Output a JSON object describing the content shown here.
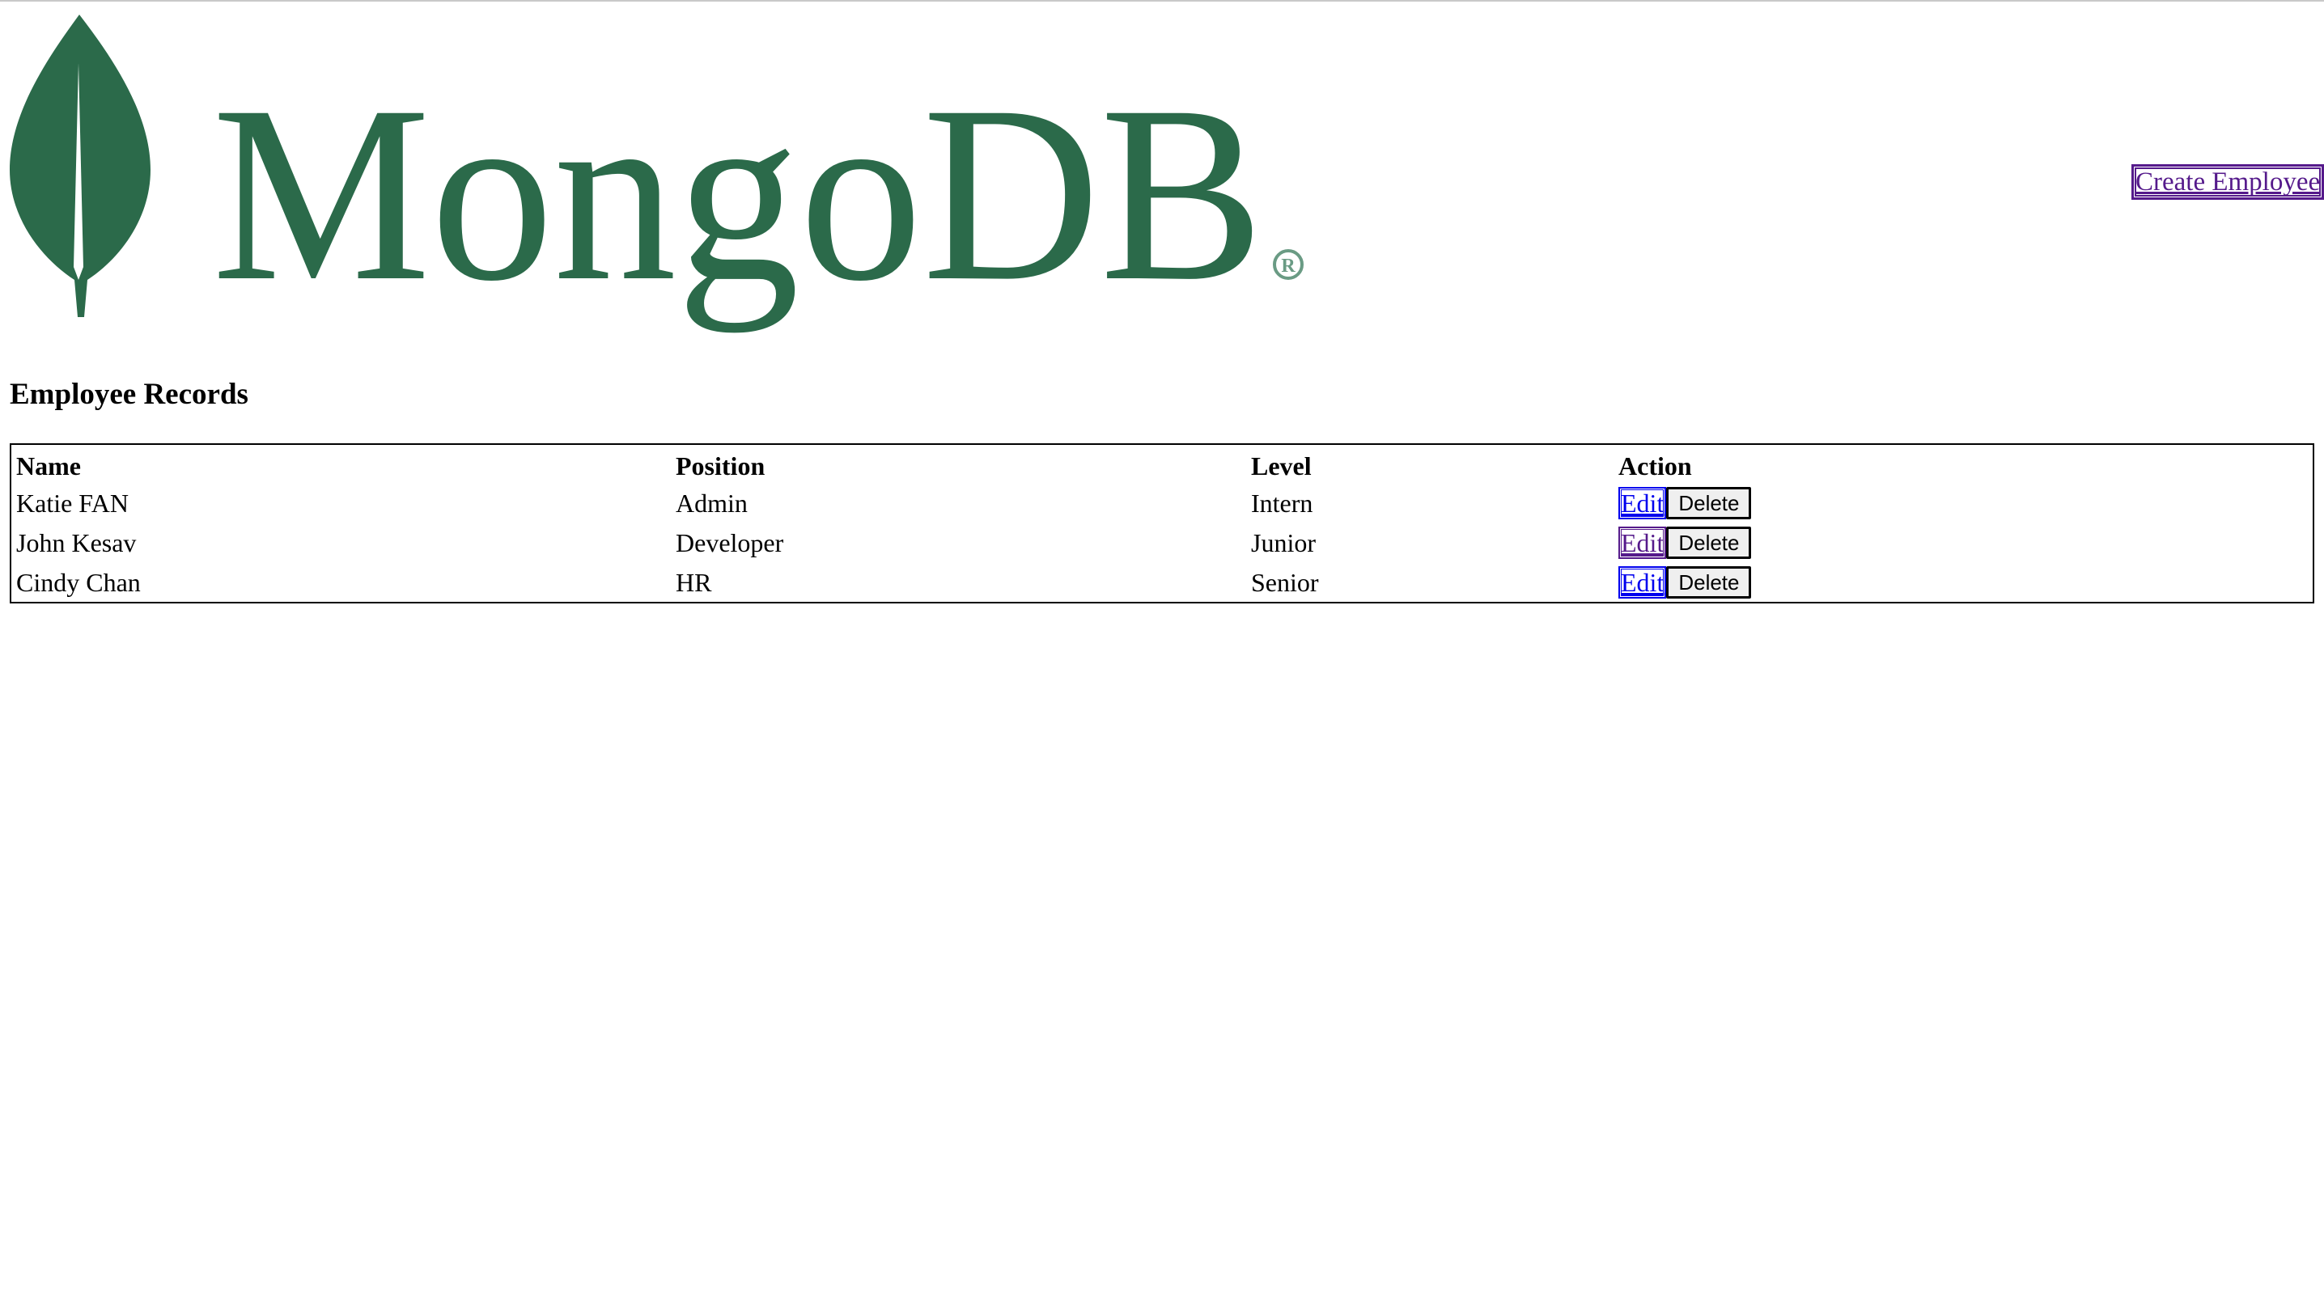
{
  "logo": {
    "wordmark": "MongoDB",
    "registered_mark": "®",
    "brand_color": "#2b6a4a",
    "icon": "leaf-icon"
  },
  "header": {
    "create_link_label": "Create Employee"
  },
  "main": {
    "title": "Employee Records",
    "table": {
      "columns": [
        "Name",
        "Position",
        "Level",
        "Action"
      ],
      "rows": [
        {
          "name": "Katie FAN",
          "position": "Admin",
          "level": "Intern",
          "edit_label": "Edit",
          "delete_label": "Delete"
        },
        {
          "name": "John Kesav",
          "position": "Developer",
          "level": "Junior",
          "edit_label": "Edit",
          "delete_label": "Delete"
        },
        {
          "name": "Cindy Chan",
          "position": "HR",
          "level": "Senior",
          "edit_label": "Edit",
          "delete_label": "Delete"
        }
      ]
    }
  },
  "colors": {
    "link": "#0000ee",
    "visited_link": "#551a8b"
  }
}
